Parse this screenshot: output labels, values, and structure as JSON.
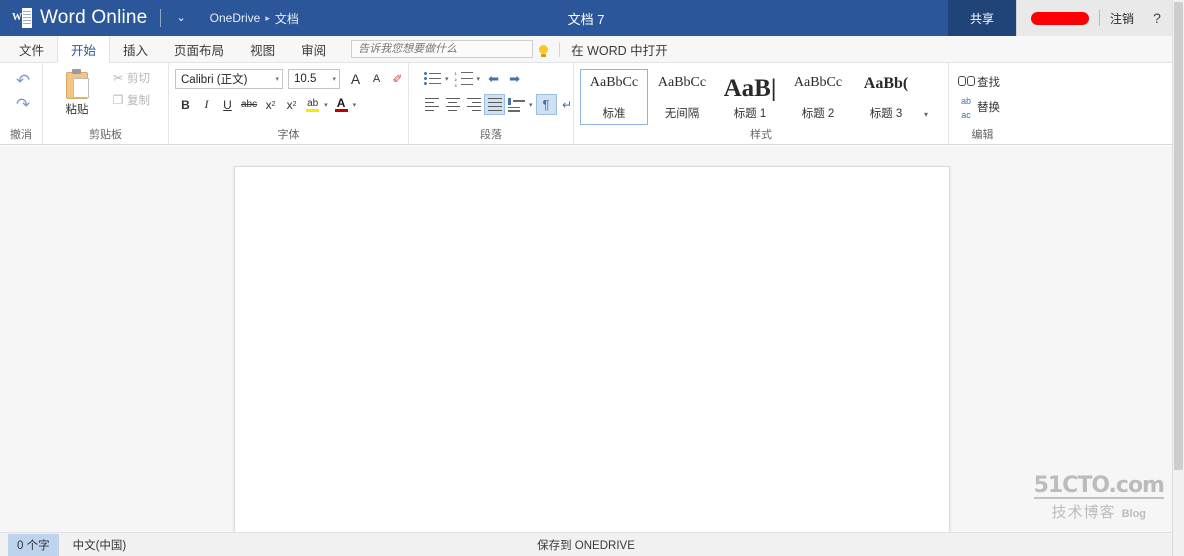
{
  "titlebar": {
    "logo_letter": "W",
    "brand": "Word Online",
    "caret": "⌄",
    "breadcrumb": {
      "root": "OneDrive",
      "separator": "▸",
      "folder": "文档"
    },
    "document_title": "文档 7",
    "share_label": "共享",
    "account_name_redacted": "",
    "signout_label": "注销",
    "help_label": "?",
    "accent_color": "#2b579a",
    "share_color": "#204478",
    "redaction_color": "#fd0006"
  },
  "tabs": [
    {
      "label": "文件",
      "active": false
    },
    {
      "label": "开始",
      "active": true
    },
    {
      "label": "插入",
      "active": false
    },
    {
      "label": "页面布局",
      "active": false
    },
    {
      "label": "视图",
      "active": false
    },
    {
      "label": "审阅",
      "active": false
    }
  ],
  "tellme": {
    "placeholder": "告诉我您想要做什么",
    "value": "",
    "bulb_icon": "lightbulb-icon"
  },
  "open_in_word": "在 WORD 中打开",
  "ribbon": {
    "undo_group": {
      "label": "撤消",
      "undo_icon": "↶",
      "redo_icon": "↷"
    },
    "clipboard_group": {
      "label": "剪贴板",
      "paste_label": "粘贴",
      "cut_label": "剪切",
      "cut_icon": "✂",
      "copy_label": "复制",
      "copy_icon": "❐"
    },
    "font_group": {
      "label": "字体",
      "font_name": "Calibri (正文)",
      "font_size": "10.5",
      "grow_font": "A",
      "shrink_font": "A",
      "clear_format_icon": "✐",
      "bold": "B",
      "italic": "I",
      "underline": "U",
      "strikethrough": "abc",
      "subscript": "x",
      "subscript_mark": "2",
      "superscript": "x",
      "superscript_mark": "2",
      "highlight": "ab",
      "font_color": "A",
      "caret": "▾"
    },
    "paragraph_group": {
      "label": "段落",
      "bullets": "bullet-list-icon",
      "numbering": "numbered-list-icon",
      "decrease_indent": "⬅",
      "increase_indent": "➡",
      "align_left": "align-left-icon",
      "align_center": "align-center-icon",
      "align_right": "align-right-icon",
      "align_justify": "align-justify-icon",
      "justify_active": true,
      "line_spacing": "line-spacing-icon",
      "show_marks": "¶",
      "show_marks_active": true,
      "clear_formatting": "↵",
      "caret": "▾"
    },
    "styles_group": {
      "label": "样式",
      "more_caret": "▾",
      "items": [
        {
          "preview": "AaBbCc",
          "name": "标准",
          "selected": true,
          "cls": "sp-normal"
        },
        {
          "preview": "AaBbCc",
          "name": "无间隔",
          "selected": false,
          "cls": "sp-nospace"
        },
        {
          "preview": "AaB|",
          "name": "标题 1",
          "selected": false,
          "cls": "sp-h1"
        },
        {
          "preview": "AaBbCc",
          "name": "标题 2",
          "selected": false,
          "cls": "sp-h2"
        },
        {
          "preview": "AaBb(",
          "name": "标题 3",
          "selected": false,
          "cls": "sp-h3"
        }
      ]
    },
    "editing_group": {
      "label": "编辑",
      "find_label": "查找",
      "find_icon": "binoculars-icon",
      "replace_label": "替换",
      "replace_icon": "replace-icon"
    }
  },
  "document": {
    "page_content": ""
  },
  "watermark": {
    "top": "51CTO.com",
    "bottom_cn": "技术博客",
    "bottom_en": "Blog"
  },
  "statusbar": {
    "word_count": "0 个字",
    "language": "中文(中国)",
    "save_state": "保存到 ONEDRIVE"
  }
}
